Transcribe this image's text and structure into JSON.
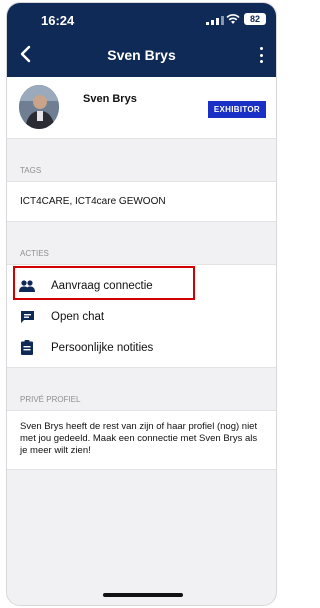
{
  "status": {
    "time": "16:24",
    "battery": "82"
  },
  "header": {
    "title": "Sven Brys"
  },
  "profile": {
    "name": "Sven Brys",
    "badge": "EXHIBITOR"
  },
  "tags": {
    "section_label": "TAGS",
    "value": "ICT4CARE, ICT4care GEWOON"
  },
  "actions": {
    "section_label": "ACTIES",
    "items": [
      {
        "label": "Aanvraag connectie",
        "icon": "people-icon"
      },
      {
        "label": "Open chat",
        "icon": "chat-icon"
      },
      {
        "label": "Persoonlijke notities",
        "icon": "notes-icon"
      }
    ]
  },
  "private_profile": {
    "section_label": "PRIVÉ PROFIEL",
    "text": "Sven Brys heeft de rest van zijn of haar profiel (nog) niet met jou gedeeld. Maak een connectie met Sven Brys als je meer wilt zien!"
  },
  "colors": {
    "header": "#0f2a56",
    "badge": "#1a2fc4",
    "highlight": "#d20000"
  }
}
